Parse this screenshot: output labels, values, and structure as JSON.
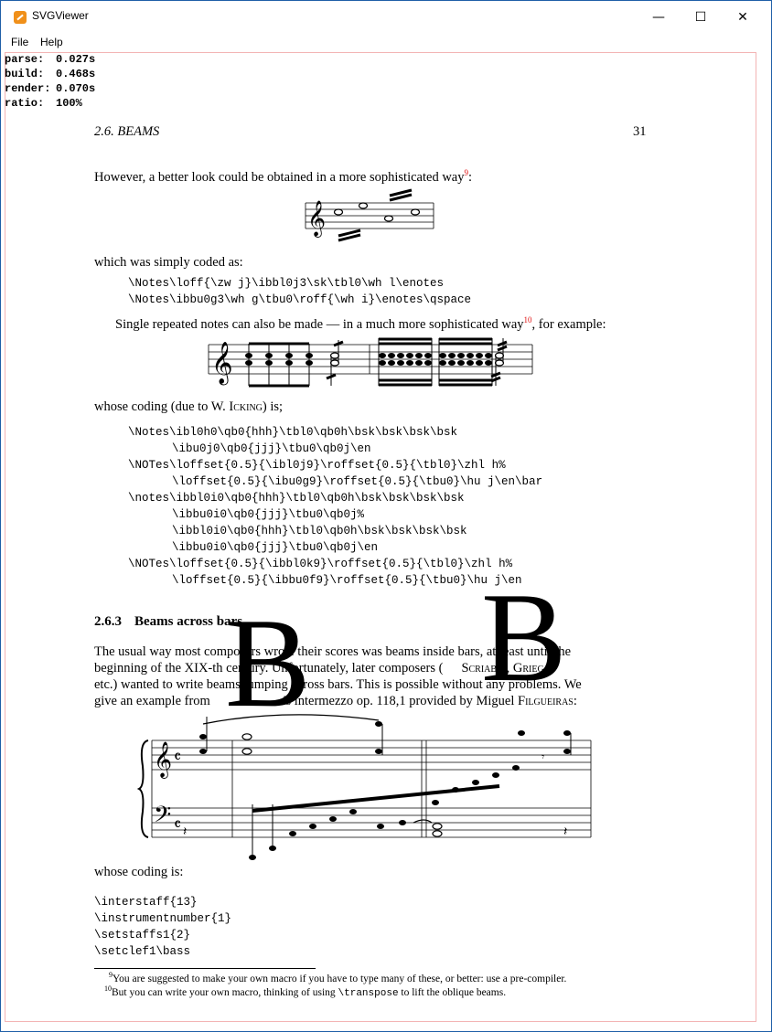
{
  "window": {
    "title": "SVGViewer",
    "minimize_glyph": "—",
    "maximize_glyph": "☐",
    "close_glyph": "✕"
  },
  "menu": {
    "file": "File",
    "help": "Help"
  },
  "stats": [
    {
      "label": "parse:",
      "value": "0.027s"
    },
    {
      "label": "build:",
      "value": "0.468s"
    },
    {
      "label": "render:",
      "value": "0.070s"
    },
    {
      "label": "ratio:",
      "value": "100%"
    }
  ],
  "page": {
    "running_head": "2.6.  BEAMS",
    "page_number": "31",
    "para1": "However, a better look could be obtained in a more sophisticated way",
    "para1_fn": "9",
    "para1_end": ":",
    "coded_as": "which was simply coded as:",
    "code1": [
      "\\Notes\\loff{\\zw j}\\ibbl0j3\\sk\\tbl0\\wh l\\enotes",
      "\\Notes\\ibbu0g3\\wh g\\tbu0\\roff{\\wh i}\\enotes\\qspace"
    ],
    "para2": "Single repeated notes can also be made — in a much more sophisticated way",
    "para2_fn": "10",
    "para2_end": ", for example:",
    "coding_due_a": "whose coding (due to W. ",
    "coding_due_name": "Icking",
    "coding_due_b": ") is;",
    "code2": [
      "\\Notes\\ibl0h0\\qb0{hhh}\\tbl0\\qb0h\\bsk\\bsk\\bsk\\bsk",
      "\\ibu0j0\\qb0{jjj}\\tbu0\\qb0j\\en",
      "\\NOTes\\loffset{0.5}{\\ibl0j9}\\roffset{0.5}{\\tbl0}\\zhl h%",
      "\\loffset{0.5}{\\ibu0g9}\\roffset{0.5}{\\tbu0}\\hu j\\en\\bar",
      "\\notes\\ibbl0i0\\qb0{hhh}\\tbl0\\qb0h\\bsk\\bsk\\bsk\\bsk",
      "\\ibbu0i0\\qb0{jjj}\\tbu0\\qb0j%",
      "\\ibbl0i0\\qb0{hhh}\\tbl0\\qb0h\\bsk\\bsk\\bsk\\bsk",
      "\\ibbu0i0\\qb0{jjj}\\tbu0\\qb0j\\en",
      "\\NOTes\\loffset{0.5}{\\ibbl0k9}\\roffset{0.5}{\\tbl0}\\zhl h%",
      "\\loffset{0.5}{\\ibbu0f9}\\roffset{0.5}{\\tbu0}\\hu j\\en"
    ],
    "section": "2.6.3",
    "section_title": "Beams across bars",
    "para3_lines": [
      "The usual way most composers wrote their scores was beams inside bars, at least until the",
      "beginning of the XIX-th century. Unfortunately, later composers (",
      "etc.) wanted to write beams jumping across bars. This is possible without any problems. We",
      "give an example from"
    ],
    "composer_scriabin": "Scriabin",
    "composer_grieg": "Grieg",
    "intermezzo": "'s intermezzo op. 118,1 provided by Miguel ",
    "author": "Filgueiras",
    "author_end": ":",
    "big_letter": "B",
    "whose_coding": "whose coding is:",
    "code3": [
      "\\interstaff{13}",
      "\\instrumentnumber{1}",
      "\\setstaffs1{2}",
      "\\setclef1\\bass"
    ],
    "footnote9_num": "9",
    "footnote9": "You are suggested to make your own macro if you have to type many of these, or better: use a pre-compiler.",
    "footnote10_num": "10",
    "footnote10_a": "But you can write your own macro, thinking of using ",
    "footnote10_code": "\\transpose",
    "footnote10_b": " to lift the oblique beams."
  },
  "colors": {
    "footnote_marker": "#e01010",
    "canvas_border": "#f3b4b4",
    "window_border": "#1f5fa8"
  }
}
